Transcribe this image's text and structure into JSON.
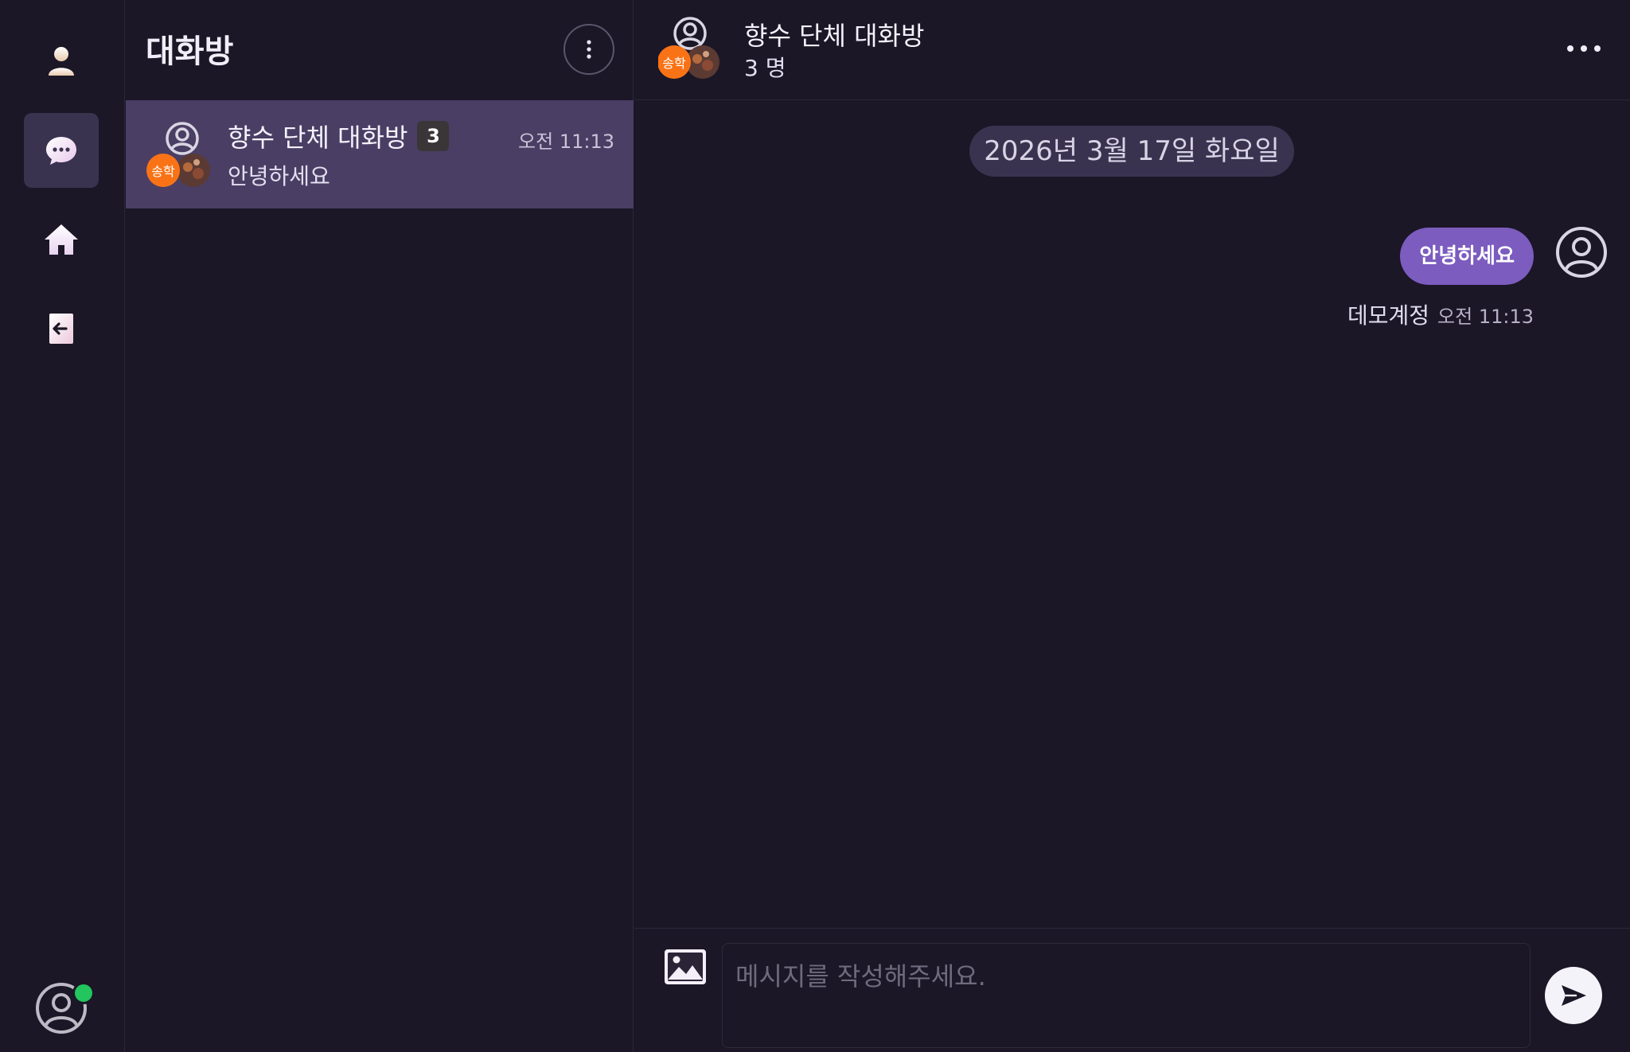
{
  "colors": {
    "background": "#1b1726",
    "active_nav": "#3a3350",
    "selected_room": "#4a3e64",
    "bubble": "#7c5cbf",
    "online": "#22c55e",
    "group_avatar_badge": "#f97316"
  },
  "rail": {
    "items": [
      {
        "name": "profile",
        "icon": "person-icon",
        "active": false
      },
      {
        "name": "chat",
        "icon": "chat-bubble-icon",
        "active": true
      },
      {
        "name": "home",
        "icon": "home-icon",
        "active": false
      },
      {
        "name": "logout",
        "icon": "exit-door-icon",
        "active": false
      }
    ],
    "me": {
      "icon": "user-avatar-icon",
      "online": true
    }
  },
  "room_list": {
    "title": "대화방",
    "rooms": [
      {
        "name": "향수 단체 대화방",
        "member_count": "3",
        "time": "오전 11:13",
        "last_message": "안녕하세요",
        "avatar_badge_text": "송학",
        "selected": true
      }
    ]
  },
  "chat": {
    "title": "향수 단체 대화방",
    "members": "3 명",
    "avatar_badge_text": "송학",
    "date_divider": "2026년 3월 17일 화요일",
    "messages": [
      {
        "text": "안녕하세요",
        "sender": "데모계정",
        "time": "오전 11:13",
        "mine": true
      }
    ]
  },
  "composer": {
    "placeholder": "메시지를 작성해주세요."
  }
}
